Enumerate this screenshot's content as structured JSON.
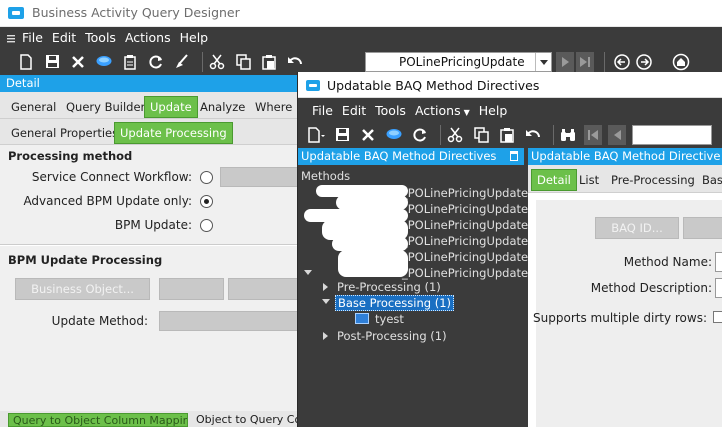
{
  "colors": {
    "accent": "#1ea1e8",
    "tab_active": "#6cc04a",
    "chrome_dark": "#3b3b3b"
  },
  "designer": {
    "title": "Business Activity Query Designer",
    "menu": [
      "File",
      "Edit",
      "Tools",
      "Actions",
      "Help"
    ],
    "toolbar_icons": [
      "new-icon",
      "save-icon",
      "delete-icon",
      "chat-icon",
      "clipboard-icon",
      "refresh-icon",
      "clear-icon",
      "cut-icon",
      "copy-icon",
      "paste-icon",
      "undo-icon"
    ],
    "query_combo": {
      "value": "POLinePricingUpdate"
    },
    "detail_header": "Detail",
    "tabs": [
      "General",
      "Query Builder",
      "Update",
      "Analyze",
      "Where U"
    ],
    "active_tab": "Update",
    "subtabs": [
      "General Properties",
      "Update Processing"
    ],
    "active_subtab": "Update Processing",
    "processing": {
      "title": "Processing method",
      "options": [
        {
          "label": "Service Connect Workflow:",
          "selected": false
        },
        {
          "label": "Advanced BPM Update only:",
          "selected": true
        },
        {
          "label": "BPM Update:",
          "selected": false
        }
      ]
    },
    "bpm": {
      "title": "BPM Update Processing",
      "business_object_button": "Business Object...",
      "update_method_label": "Update Method:"
    },
    "bottom_tabs": [
      "Query to Object Column Mapping",
      "Object to Query Co"
    ]
  },
  "directives": {
    "title": "Updatable BAQ Method Directives",
    "menu": [
      "File",
      "Edit",
      "Tools",
      "Actions",
      "Help"
    ],
    "toolbar_icons": [
      "new-icon",
      "save-icon",
      "delete-icon",
      "chat-icon",
      "refresh-icon",
      "cut-icon",
      "copy-icon",
      "paste-icon",
      "undo-icon",
      "binoculars-icon"
    ],
    "tree_header": "Updatable BAQ Method Directives",
    "tree": {
      "root": "Methods",
      "methods": [
        "_POLinePricingUpdate.",
        "_POLinePricingUpdate.",
        "_POLinePricingUpdate.",
        "_POLinePricingUpdate.",
        "_POLinePricingUpdate.",
        "_POLinePricingUpdate."
      ],
      "groups": [
        {
          "label": "Pre-Processing (1)",
          "expanded": false
        },
        {
          "label": "Base Processing (1)",
          "expanded": true,
          "selected": true
        },
        {
          "label": "Post-Processing (1)",
          "expanded": false
        }
      ],
      "child": "tyest"
    },
    "main_header": "Updatable BAQ Method Directive Mai",
    "main_tabs": [
      "Detail",
      "List",
      "Pre-Processing",
      "Bas"
    ],
    "active_main_tab": "Detail",
    "baq_button": "BAQ ID...",
    "fields": {
      "method_name": "Method Name:",
      "method_description": "Method Description:",
      "supports_dirty": "Supports multiple dirty rows:"
    }
  }
}
